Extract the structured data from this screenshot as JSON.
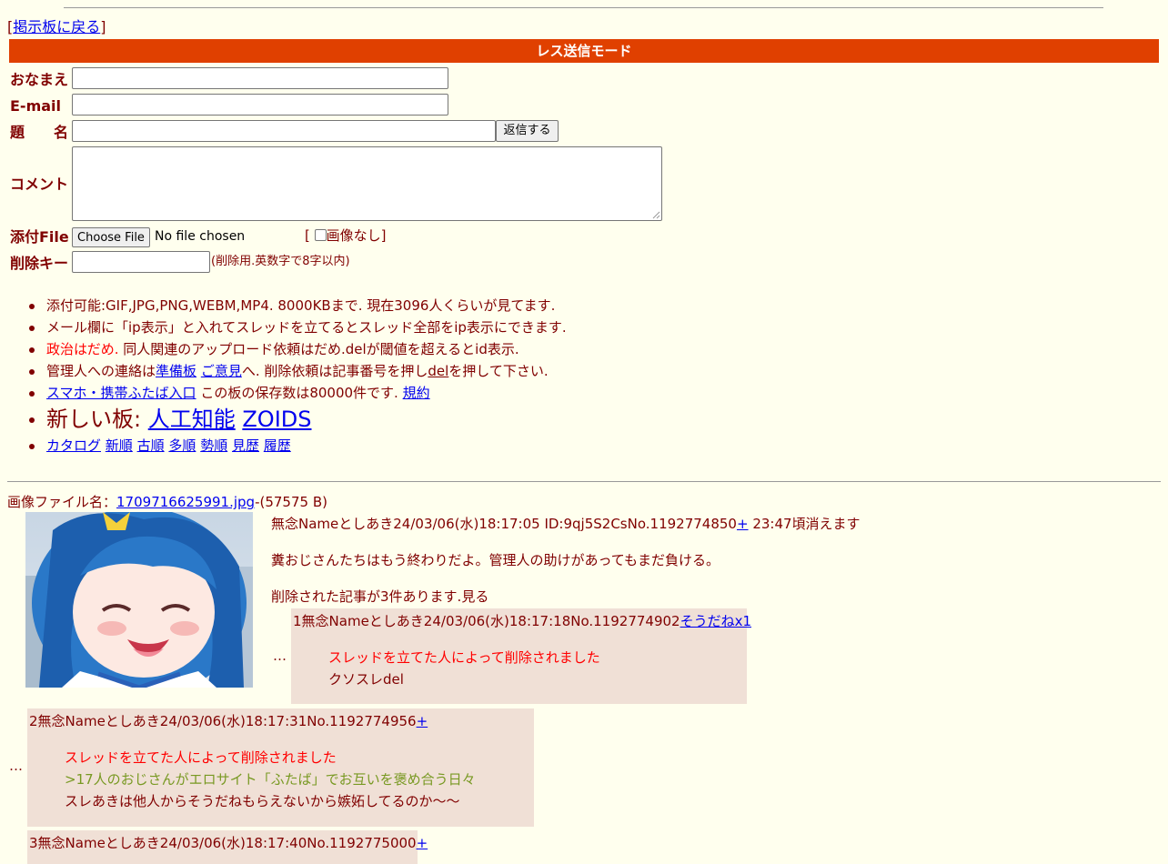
{
  "nav": {
    "back_open": "[",
    "back_link": "掲示板に戻る",
    "back_close": "]"
  },
  "mode_bar": "レス送信モード",
  "form": {
    "name_label": "おなまえ",
    "email_label": "E-mail",
    "subject_label": "題　　名",
    "submit_label": "返信する",
    "comment_label": "コメント",
    "file_label": "添付File",
    "choose_file_label": "Choose File",
    "no_file_text": "No file chosen",
    "noimage_open": "[",
    "noimage_label": "画像なし",
    "noimage_close": "]",
    "delkey_label": "削除キー",
    "delkey_hint": "(削除用.英数字で8字以内)"
  },
  "rules": {
    "r1": "添付可能:GIF,JPG,PNG,WEBM,MP4. 8000KBまで. 現在3096人くらいが見てます.",
    "r2": "メール欄に「ip表示」と入れてスレッドを立てるとスレッド全部をip表示にできます.",
    "r3_red": "政治はだめ.",
    "r3_rest": " 同人関連のアップロード依頼はだめ.delが閾値を超えるとid表示.",
    "r4_a": "管理人への連絡は",
    "r4_link1": "準備板",
    "r4_link2": "ご意見",
    "r4_b": "へ. 削除依頼は記事番号を押し",
    "r4_link3": "del",
    "r4_c": "を押して下さい.",
    "r5_link": "スマホ・携帯ふたば入口",
    "r5_text": " この板の保存数は80000件です.",
    "r5_link2": "規約",
    "r6_text": "新しい板: ",
    "r6_link1": "人工知能",
    "r6_link2": "ZOIDS",
    "r7_links": [
      "カタログ",
      "新順",
      "古順",
      "多順",
      "勢順",
      "見歴",
      "履歴"
    ]
  },
  "op": {
    "file_prefix": "画像ファイル名：",
    "file_name": "1709716625991.jpg",
    "file_size": "-(57575 B)",
    "header": "無念Nameとしあき24/03/06(水)18:17:05 ID:9qj5S2CsNo.1192774850",
    "plus": "+",
    "expiry": " 23:47頃消えます",
    "body": "糞おじさんたちはもう終わりだよ。管理人の助けがあってもまだ負ける。",
    "deleted_note": "削除された記事が3件あります.見る"
  },
  "replies": [
    {
      "header": "1無念Nameとしあき24/03/06(水)18:17:18No.1192774902",
      "link": "そうだねx1",
      "removed": "スレッドを立てた人によって削除されました",
      "lines": [
        "クソスレdel"
      ]
    },
    {
      "header": "2無念Nameとしあき24/03/06(水)18:17:31No.1192774956",
      "link": "+",
      "removed": "スレッドを立てた人によって削除されました",
      "quote": ">17人のおじさんがエロサイト「ふたば」でお互いを褒め合う日々",
      "lines": [
        "スレあきは他人からそうだねもらえないから嫉妬してるのか〜〜"
      ]
    },
    {
      "header": "3無念Nameとしあき24/03/06(水)18:17:40No.1192775000",
      "link": "+"
    }
  ],
  "dots": "…"
}
